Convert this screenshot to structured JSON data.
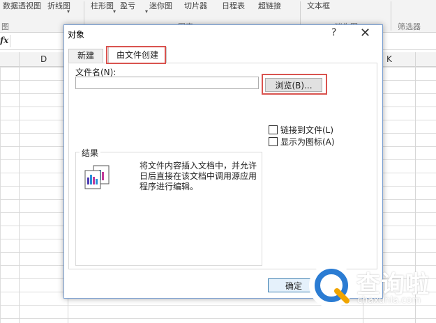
{
  "ribbon": {
    "top_items": [
      "数据透视图",
      "折线图",
      "柱形图",
      "盈亏",
      "迷你图",
      "切片器",
      "日程表",
      "超链接",
      "文本框"
    ],
    "groups": [
      "图",
      "图表",
      "迷你图",
      "筛选器"
    ]
  },
  "formula_bar": {
    "fx": "fx"
  },
  "columns": {
    "d": "D",
    "k": "K"
  },
  "dialog": {
    "title": "对象",
    "help": "?",
    "close": "✕",
    "tabs": [
      "新建",
      "由文件创建"
    ],
    "filename_label": "文件名(N):",
    "filename_value": "",
    "browse_label": "浏览(B)...",
    "link_label": "链接到文件(L)",
    "icon_label": "显示为图标(A)",
    "result_label": "结果",
    "result_text": "将文件内容插入文档中，并允许日后直接在该文档中调用源应用程序进行编辑。",
    "ok_label": "确定"
  },
  "watermark": {
    "brand": "查询啦",
    "url": "chaxunla.com",
    "accent": "#2b7cd3"
  }
}
